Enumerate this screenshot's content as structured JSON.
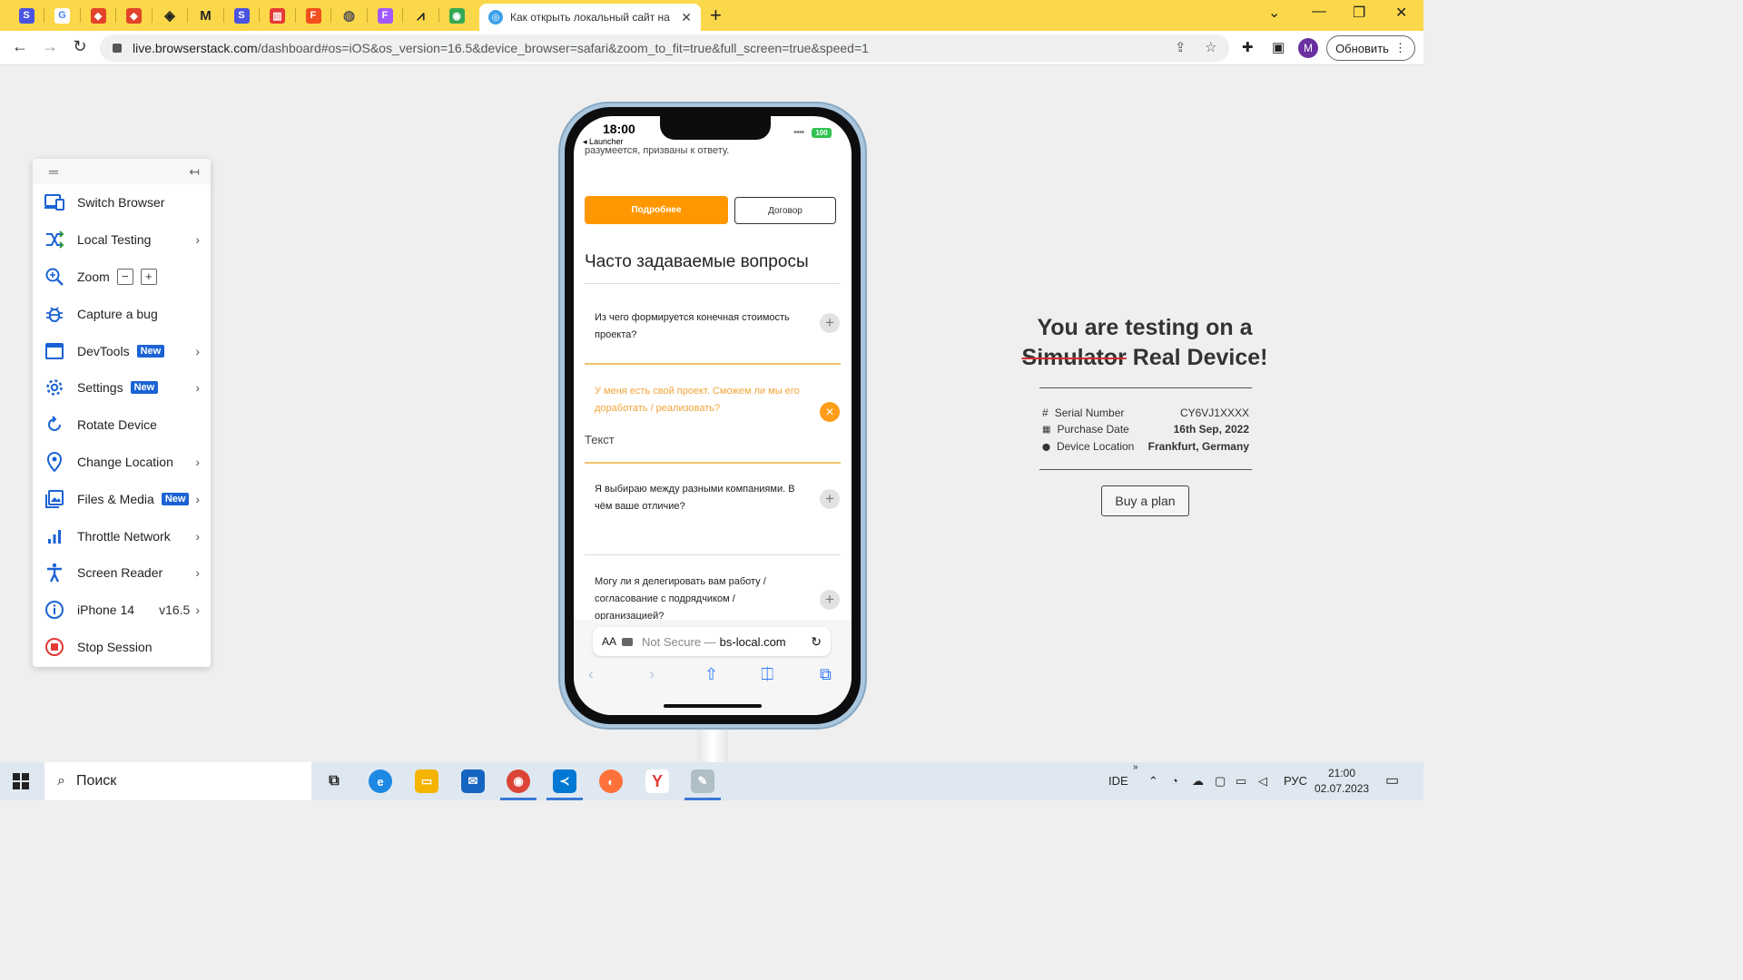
{
  "browser": {
    "pinned_tabs": [
      {
        "icon": "s-square-icon",
        "glyph": "S",
        "color": "#4a52e0"
      },
      {
        "icon": "google-icon",
        "glyph": "G",
        "color": "#ffffff"
      },
      {
        "icon": "gitlab-icon",
        "glyph": "◆",
        "color": "#e24329"
      },
      {
        "icon": "gitlab-icon",
        "glyph": "◆",
        "color": "#e24329"
      },
      {
        "icon": "diamond-icon",
        "glyph": "◈",
        "color": "#222222"
      },
      {
        "icon": "mu-icon",
        "glyph": "M",
        "color": "#222222"
      },
      {
        "icon": "s-square-icon",
        "glyph": "S",
        "color": "#4a52e0"
      },
      {
        "icon": "red-bars-icon",
        "glyph": "▥",
        "color": "#e53935"
      },
      {
        "icon": "figma-icon",
        "glyph": "F",
        "color": "#f24e1e"
      },
      {
        "icon": "globe-icon",
        "glyph": "◍",
        "color": "#555555"
      },
      {
        "icon": "figma-icon",
        "glyph": "F",
        "color": "#a259ff"
      },
      {
        "icon": "compass-icon",
        "glyph": "⩘",
        "color": "#222222"
      },
      {
        "icon": "chrome-icon",
        "glyph": "◉",
        "color": "#34a853"
      }
    ],
    "active_tab": {
      "title": "Как открыть локальный сайт на",
      "close": "✕"
    },
    "new_tab": "+",
    "url_host": "live.browserstack.com",
    "url_rest": "/dashboard#os=iOS&os_version=16.5&device_browser=safari&zoom_to_fit=true&full_screen=true&speed=1",
    "avatar_letter": "M",
    "update_label": "Обновить"
  },
  "side_menu": {
    "items": [
      {
        "label": "Switch Browser",
        "icon": "switch-browser-icon"
      },
      {
        "label": "Local Testing",
        "icon": "local-testing-icon"
      },
      {
        "label": "Zoom",
        "icon": "zoom-icon",
        "minus": "−",
        "plus": "+"
      },
      {
        "label": "Capture a bug",
        "icon": "bug-icon"
      },
      {
        "label": "DevTools",
        "icon": "devtools-icon",
        "badge": "New"
      },
      {
        "label": "Settings",
        "icon": "settings-icon",
        "badge": "New"
      },
      {
        "label": "Rotate Device",
        "icon": "rotate-icon"
      },
      {
        "label": "Change Location",
        "icon": "location-icon"
      },
      {
        "label": "Files & Media",
        "icon": "media-icon",
        "badge": "New"
      },
      {
        "label": "Throttle Network",
        "icon": "network-icon"
      },
      {
        "label": "Screen Reader",
        "icon": "accessibility-icon"
      },
      {
        "label": "iPhone 14",
        "icon": "info-icon",
        "version": "v16.5"
      },
      {
        "label": "Stop Session",
        "icon": "stop-icon"
      }
    ],
    "chevron": "›"
  },
  "phone": {
    "status": {
      "time": "18:00",
      "launcher": "◂ Launcher",
      "battery": "100"
    },
    "cut_text": "разумеется, призваны к ответу.",
    "btn_more": "Подробнее",
    "btn_contract": "Договор",
    "faq_title": "Часто задаваемые вопросы",
    "faq": [
      {
        "q": "Из чего формируется конечная стоимость проекта?"
      },
      {
        "q": "У меня есть свой проект. Сможем ли мы его доработать / реализовать?",
        "answer": "Текст"
      },
      {
        "q": "Я выбираю между разными компаниями. В чём ваше отличие?"
      },
      {
        "q": "Могу ли я делегировать вам работу / согласование с подрядчиком / организацией?"
      }
    ],
    "safari": {
      "aa": "AA",
      "not_secure": "Not Secure —",
      "host": "bs-local.com"
    }
  },
  "info_panel": {
    "title_line1": "You are testing on a",
    "title_strike": "Simulator",
    "title_rest": "Real Device!",
    "rows": [
      {
        "key": "Serial Number",
        "value": "CY6VJ1XXXX",
        "icon": "hash-icon",
        "glyph": "#"
      },
      {
        "key": "Purchase Date",
        "value": "16th Sep, 2022",
        "icon": "calendar-icon",
        "glyph": "▦"
      },
      {
        "key": "Device Location",
        "value": "Frankfurt, Germany",
        "icon": "pin-icon",
        "glyph": "⬤"
      }
    ],
    "buy_label": "Buy a plan"
  },
  "taskbar": {
    "search_placeholder": "Поиск",
    "tray_ide": "IDE",
    "tray_lang": "РУС",
    "time": "21:00",
    "date": "02.07.2023"
  }
}
